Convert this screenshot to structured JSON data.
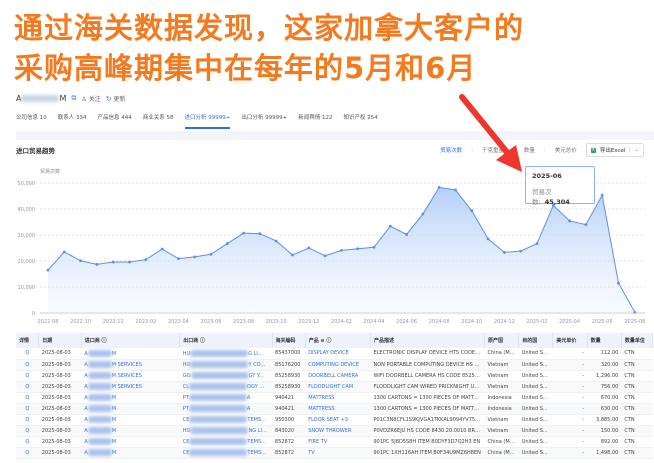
{
  "headline": {
    "line1": "通过海关数据发现，这家加拿大客户的",
    "line2": "采购高峰期集中在每年的5月和6月"
  },
  "company": {
    "name_prefix": "A",
    "name_suffix": "M",
    "follow_label": "关注",
    "update_label": "更新"
  },
  "tabs": [
    {
      "label": "公司信息 10"
    },
    {
      "label": "联系人 334"
    },
    {
      "label": "产品信息 444"
    },
    {
      "label": "商业关系 58"
    },
    {
      "label": "进口分析 99999+",
      "active": true
    },
    {
      "label": "出口分析 99999+"
    },
    {
      "label": "新闻舆情 122"
    },
    {
      "label": "知识产权 254"
    }
  ],
  "section": {
    "title": "进口贸易趋势"
  },
  "toolbar": {
    "metrics": [
      "贸易次数",
      "千克重量",
      "数量",
      "美元总价"
    ],
    "export_label": "导出Excel",
    "export_icon": "excel-icon"
  },
  "tooltip": {
    "date": "2025-06",
    "label": "贸易次数:",
    "value": "45,304"
  },
  "colors": {
    "accent": "#2f6fe4",
    "headline": "#f47a1f",
    "line": "#5b8ff0",
    "arrow": "#f0362c"
  },
  "chart_data": {
    "type": "area",
    "ylabel": "贸易次数",
    "ylim": [
      0,
      50000
    ],
    "yticks": [
      "0",
      "10,000",
      "20,000",
      "30,000",
      "40,000",
      "50,000"
    ],
    "xticks": [
      "2022-08",
      "2022-10",
      "2022-12",
      "2023-02",
      "2023-04",
      "2023-06",
      "2023-08",
      "2023-10",
      "2023-12",
      "2024-02",
      "2024-04",
      "2024-06",
      "2024-08",
      "2024-10",
      "2024-12",
      "2025-02",
      "2025-04",
      "2025-06",
      "2025-08"
    ],
    "x": [
      "2022-08",
      "2022-09",
      "2022-10",
      "2022-11",
      "2022-12",
      "2023-01",
      "2023-02",
      "2023-03",
      "2023-04",
      "2023-05",
      "2023-06",
      "2023-07",
      "2023-08",
      "2023-09",
      "2023-10",
      "2023-11",
      "2023-12",
      "2024-01",
      "2024-02",
      "2024-03",
      "2024-04",
      "2024-05",
      "2024-06",
      "2024-07",
      "2024-08",
      "2024-09",
      "2024-10",
      "2024-11",
      "2024-12",
      "2025-01",
      "2025-02",
      "2025-03",
      "2025-04",
      "2025-05",
      "2025-06",
      "2025-07",
      "2025-08"
    ],
    "series": [
      {
        "name": "贸易次数",
        "values": [
          16500,
          23500,
          20100,
          18700,
          19600,
          19600,
          20500,
          24600,
          20900,
          21600,
          22600,
          26700,
          30700,
          30500,
          27700,
          22300,
          25000,
          22000,
          24100,
          24700,
          25300,
          33400,
          30200,
          38100,
          48300,
          47300,
          39300,
          28500,
          23300,
          23800,
          26700,
          41400,
          35400,
          34000,
          45304,
          11500,
          300
        ]
      }
    ],
    "grid": true,
    "legend": "none"
  },
  "table": {
    "headers": [
      "详情",
      "日期",
      "进口商 ⓘ",
      "出口商 ⓘ",
      "海关编码",
      "产品 ≡ ⓘ",
      "产品描述",
      "原产国",
      "目的国",
      "美元单价",
      "数量",
      "数量单位"
    ],
    "rows": [
      {
        "detail": "Q",
        "date": "2025-08-03",
        "importer_pre": "A",
        "importer_suf": "M",
        "exporter_pre": "HU",
        "exporter_suf": "G LI...",
        "hs": "85437000",
        "product": "DISPLAY DEVICE",
        "desc": "ELECTRONIC DISPLAY DEVICE HTS CODE 8543",
        "origin": "China (M...",
        "dest": "United S...",
        "price": "-",
        "qty": "112.00",
        "unit": "CTN"
      },
      {
        "detail": "Q",
        "date": "2025-08-03",
        "importer_pre": "A",
        "importer_suf": "M SERVICES",
        "exporter_pre": "HO",
        "exporter_suf": "Y CO...",
        "hs": "85176200",
        "product": "COMPUTING DEVICE",
        "desc": "NON PORTABLE COMPUTING DEVICE HS CODE",
        "origin": "Vietnam",
        "dest": "United S...",
        "price": "-",
        "qty": "320.00",
        "unit": "CTN"
      },
      {
        "detail": "Q",
        "date": "2025-08-03",
        "importer_pre": "A",
        "importer_suf": "M SERVICES",
        "exporter_pre": "GO",
        "exporter_suf": "GY Y...",
        "hs": "85258930",
        "product": "DOORBELL CAMERA",
        "desc": "WIFI DOORBELL CAMERA HS CODE 8525893",
        "origin": "Vietnam",
        "dest": "United S...",
        "price": "-",
        "qty": "1,296.00",
        "unit": "CTN"
      },
      {
        "detail": "Q",
        "date": "2025-08-03",
        "importer_pre": "A",
        "importer_suf": "M SERVICES",
        "exporter_pre": "CL",
        "exporter_suf": "OGY ...",
        "hs": "85258930",
        "product": "FLOODLIGHT CAM",
        "desc": "FLOODLIGHT CAM WIRED PRICKNIGHT US B",
        "origin": "Vietnam",
        "dest": "United S...",
        "price": "-",
        "qty": "756.00",
        "unit": "CTN"
      },
      {
        "detail": "Q",
        "date": "2025-08-03",
        "importer_pre": "A",
        "importer_suf": "M",
        "exporter_pre": "PT",
        "exporter_suf": "A",
        "hs": "940421",
        "product": "MATTRESS",
        "desc": "1300 CARTONS = 1300 PIECES OF MATTRES",
        "origin": "Indonesia",
        "dest": "United S...",
        "price": "-",
        "qty": "670.00",
        "unit": "CTN"
      },
      {
        "detail": "Q",
        "date": "2025-08-03",
        "importer_pre": "A",
        "importer_suf": "M",
        "exporter_pre": "PT",
        "exporter_suf": "A",
        "hs": "940421",
        "product": "MATTRESS",
        "desc": "1300 CARTONS = 1300 PIECES OF MATTRES",
        "origin": "Indonesia",
        "dest": "United S...",
        "price": "-",
        "qty": "630.00",
        "unit": "CTN"
      },
      {
        "detail": "Q",
        "date": "2025-08-03",
        "importer_pre": "A",
        "importer_suf": "M",
        "exporter_pre": "CE",
        "exporter_suf": "TEMS...",
        "hs": "950300",
        "product": "FLOOR SEAT  +3",
        "desc": "P01C3N8CFL1S9KJVGA1TKKAL9094YV75U6U",
        "origin": "Vietnam",
        "dest": "United S...",
        "price": "-",
        "qty": "3,885.00",
        "unit": "CTN"
      },
      {
        "detail": "Q",
        "date": "2025-08-03",
        "importer_pre": "A",
        "importer_suf": "M",
        "exporter_pre": "HO",
        "exporter_suf": "NG LI...",
        "hs": "843020",
        "product": "SNOW THROWER",
        "desc": "P0VDZR6EJU HS CODE 8430.20.0010 BRUSH",
        "origin": "Vietnam",
        "dest": "United S...",
        "price": "-",
        "qty": "150.00",
        "unit": "CTN"
      },
      {
        "detail": "Q",
        "date": "2025-08-03",
        "importer_pre": "A",
        "importer_suf": "M",
        "exporter_pre": "CE",
        "exporter_suf": "TEMS...",
        "hs": "852872",
        "product": "FIRE TV",
        "desc": "901PC 5J8D5S8H ITEM B0DYF3D7Q2H3 EN",
        "origin": "China (M...",
        "dest": "United S...",
        "price": "-",
        "qty": "892.00",
        "unit": "CTN"
      },
      {
        "detail": "Q",
        "date": "2025-08-03",
        "importer_pre": "A",
        "importer_suf": "M",
        "exporter_pre": "CE",
        "exporter_suf": "TEMS...",
        "hs": "852872",
        "product": "TV",
        "desc": "901PC 1XH116AH ITEM B0F34U9MZ6H8EN",
        "origin": "China (M...",
        "dest": "United S...",
        "price": "-",
        "qty": "1,498.00",
        "unit": "CTN"
      }
    ]
  }
}
